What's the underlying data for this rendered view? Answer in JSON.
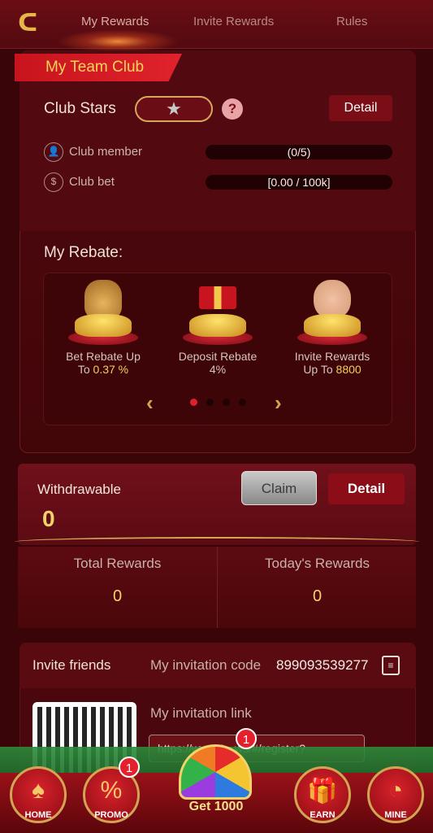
{
  "nav": {
    "tabs": [
      "My Rewards",
      "Invite Rewards",
      "Rules"
    ],
    "active_tab": "My Rewards"
  },
  "club": {
    "title": "My Team Club",
    "stars_label": "Club Stars",
    "detail_label": "Detail",
    "member_label": "Club member",
    "member_value": "(0/5)",
    "bet_label": "Club bet",
    "bet_value": "[0.00 / 100k]"
  },
  "rebate": {
    "title": "My Rebate:",
    "items": [
      {
        "name": "Bet Rebate Up",
        "prefix": "To ",
        "value": "0.37 %"
      },
      {
        "name": "Deposit Rebate",
        "prefix": "",
        "value": "4%"
      },
      {
        "name": "Invite Rewards",
        "prefix": "Up To ",
        "value": "8800"
      }
    ],
    "page": 1,
    "pages": 4
  },
  "withdraw": {
    "label": "Withdrawable",
    "value": "0",
    "claim_label": "Claim",
    "detail_label": "Detail"
  },
  "totals": {
    "total_label": "Total Rewards",
    "total_value": "0",
    "today_label": "Today's Rewards",
    "today_value": "0"
  },
  "invite": {
    "title": "Invite friends",
    "code_label": "My invitation code",
    "code": "899093539277",
    "link_label": "My invitation link",
    "link": "https://www.1...ws/#/register?"
  },
  "bottom_nav": {
    "home": "HOME",
    "promo": "PROMO",
    "promo_badge": "1",
    "wheel_badge": "1",
    "wheel_label": "Get 1000",
    "earn": "EARN",
    "mine": "MINE"
  },
  "colors": {
    "background": "#3a0509",
    "accent_red": "#e0202c",
    "gold": "#f2d36a"
  }
}
